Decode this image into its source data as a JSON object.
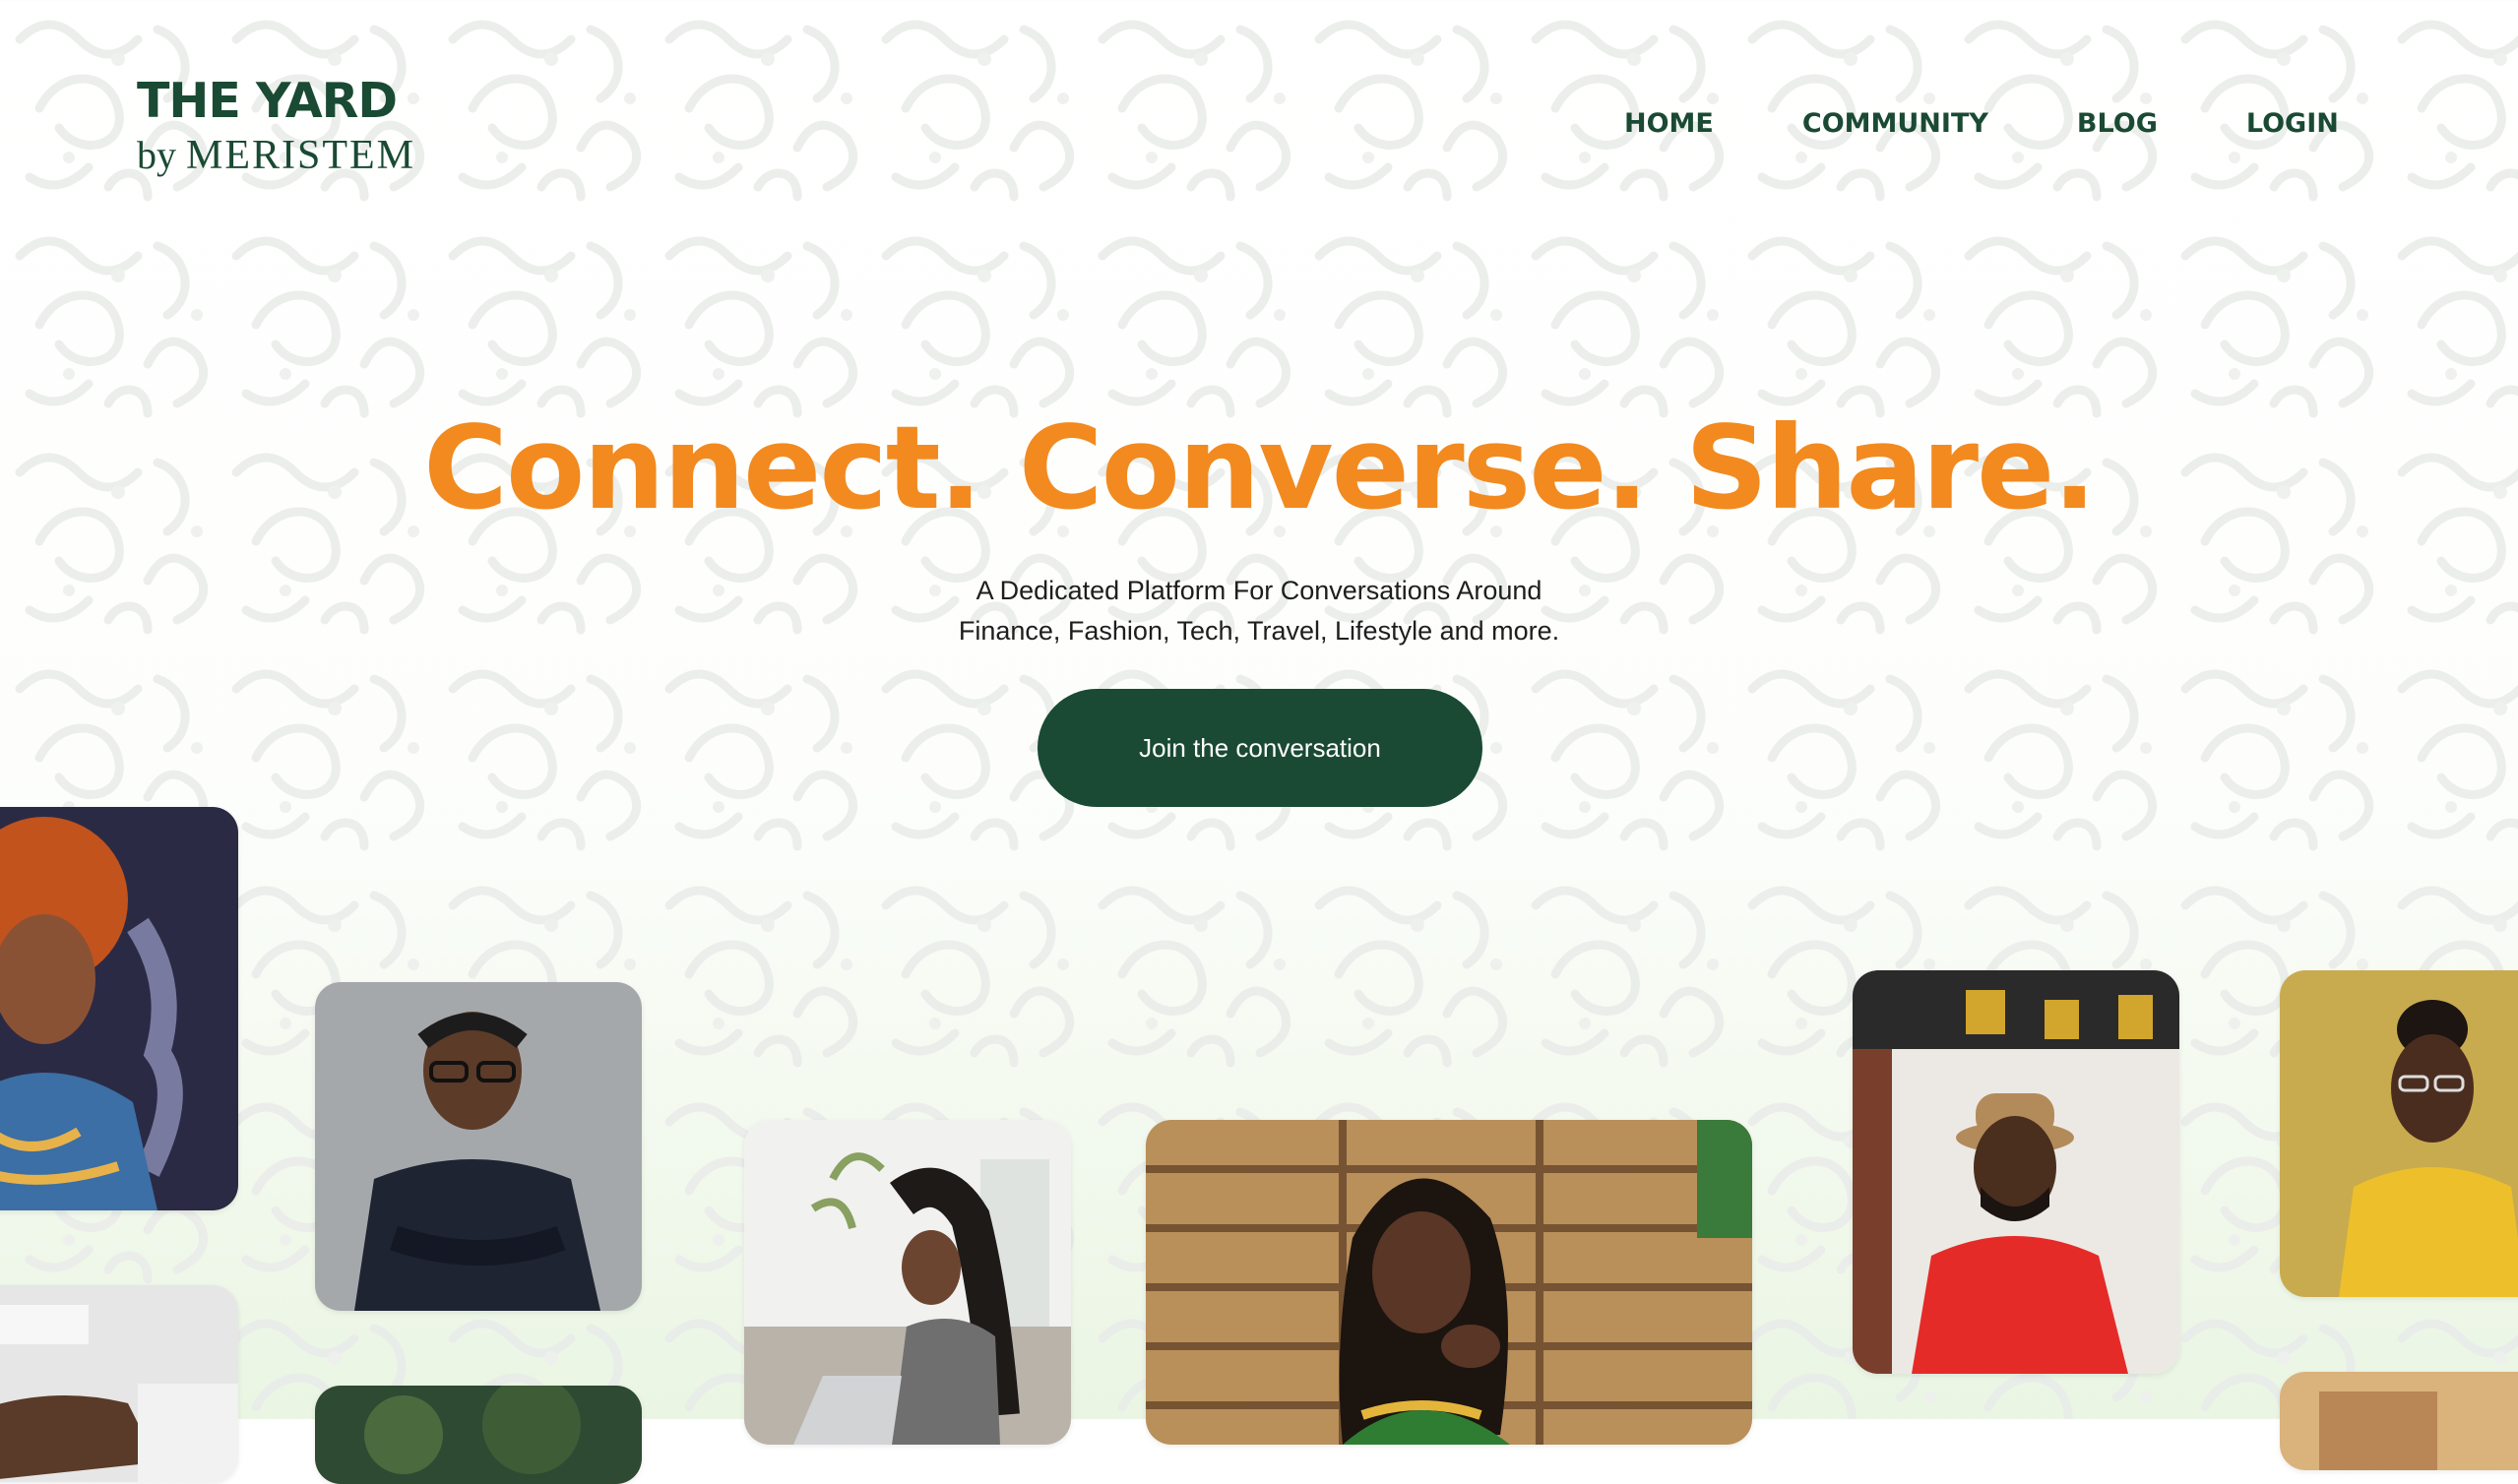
{
  "brand": {
    "title": "THE YARD",
    "by": "by",
    "name": "MERISTEM"
  },
  "nav": {
    "home": "HOME",
    "community": "COMMUNITY",
    "blog": "BLOG",
    "login": "LOGIN"
  },
  "hero": {
    "headline": "Connect. Converse. Share.",
    "sub_line1": "A Dedicated Platform For Conversations Around",
    "sub_line2": "Finance, Fashion, Tech, Travel, Lifestyle and more.",
    "cta_label": "Join the conversation"
  },
  "colors": {
    "brand_green": "#1a4a33",
    "accent_orange": "#f28a1f"
  },
  "photos": [
    "woman-red-afro-photo",
    "man-glasses-crossed-arms-photo",
    "woman-laptop-sofa-photo",
    "woman-braids-smiling-photo",
    "man-hat-red-shirt-photo",
    "woman-yellow-sweater-photo"
  ]
}
